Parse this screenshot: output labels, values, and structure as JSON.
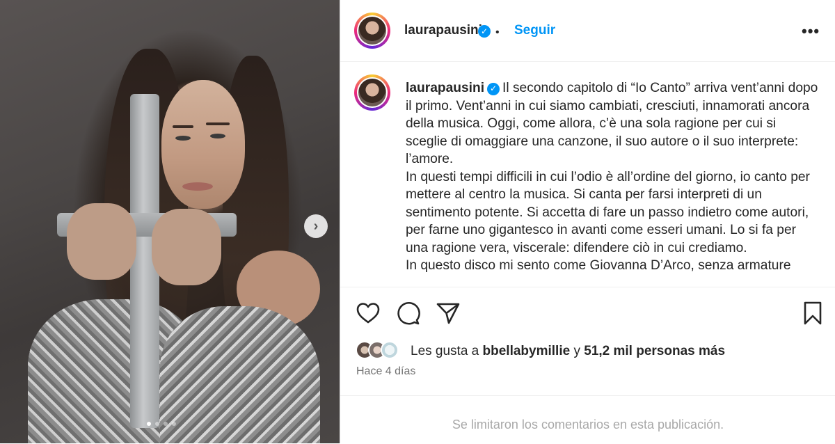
{
  "post": {
    "username": "laurapausini",
    "follow_label": "Seguir",
    "bullet": "•",
    "more_label": "•••",
    "verified_mark": "✓"
  },
  "caption": {
    "username": "laurapausini",
    "paragraphs": [
      "Il secondo capitolo di “Io Canto” arriva vent’anni dopo il primo. Vent’anni in cui siamo cambiati, cresciuti, innamorati ancora della musica. Oggi, come allora, c’è una sola ragione per cui si sceglie di omaggiare una canzone, il suo autore o il suo interprete: l’amore.",
      "In questi tempi difficili in cui l’odio è all’ordine del giorno, io canto per mettere al centro la musica. Si canta per farsi interpreti di un sentimento potente. Si accetta di fare un passo indietro come autori, per farne uno gigantesco in avanti come esseri umani. Lo si fa per una ragione vera, viscerale: difendere ciò in cui crediamo.",
      "In questo disco mi sento come Giovanna D’Arco, senza armature"
    ]
  },
  "media": {
    "next_arrow": "›",
    "carousel_total": 4,
    "carousel_active": 1
  },
  "likes": {
    "prefix": "Les gusta a",
    "liker": "bbellabymillie",
    "joiner": "y",
    "rest": "51,2 mil personas más"
  },
  "time_ago": "Hace 4 días",
  "comments_disabled": "Se limitaron los comentarios en esta publicación.",
  "icons": {
    "like": "heart-icon",
    "comment": "comment-icon",
    "share": "share-icon",
    "save": "bookmark-icon",
    "more": "more-options-icon",
    "next": "chevron-right-icon"
  },
  "colors": {
    "link_blue": "#0095f6",
    "text": "#262626",
    "muted": "#737373",
    "disabled": "#a8a8a8"
  }
}
